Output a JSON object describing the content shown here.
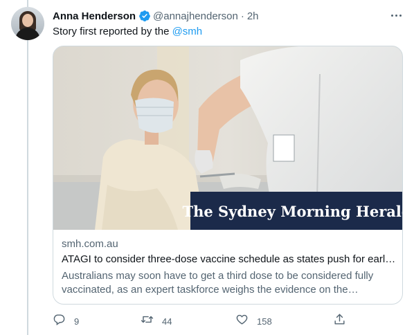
{
  "author": {
    "name": "Anna Henderson",
    "handle": "@annajhenderson",
    "separator": "·",
    "time": "2h",
    "verified": true
  },
  "tweet": {
    "text_prefix": "Story first reported by the",
    "mention": "@smh"
  },
  "card": {
    "image_caption": "The Sydney Morning Herald",
    "domain": "smh.com.au",
    "title": "ATAGI to consider three-dose vaccine schedule as states push for earlie...",
    "description": "Australians may soon have to get a third dose to be considered fully vaccinated, as an expert taskforce weighs the evidence on the Omicron..."
  },
  "actions": {
    "reply_count": "9",
    "retweet_count": "44",
    "like_count": "158"
  },
  "icons": {
    "verified": "verified-badge-icon",
    "more": "more-options-icon",
    "reply": "reply-icon",
    "retweet": "retweet-icon",
    "like": "heart-icon",
    "share": "share-icon"
  },
  "colors": {
    "accent": "#1d9bf0",
    "secondary_text": "#536471",
    "border": "#cfd9de",
    "banner": "#1b2a4a"
  }
}
